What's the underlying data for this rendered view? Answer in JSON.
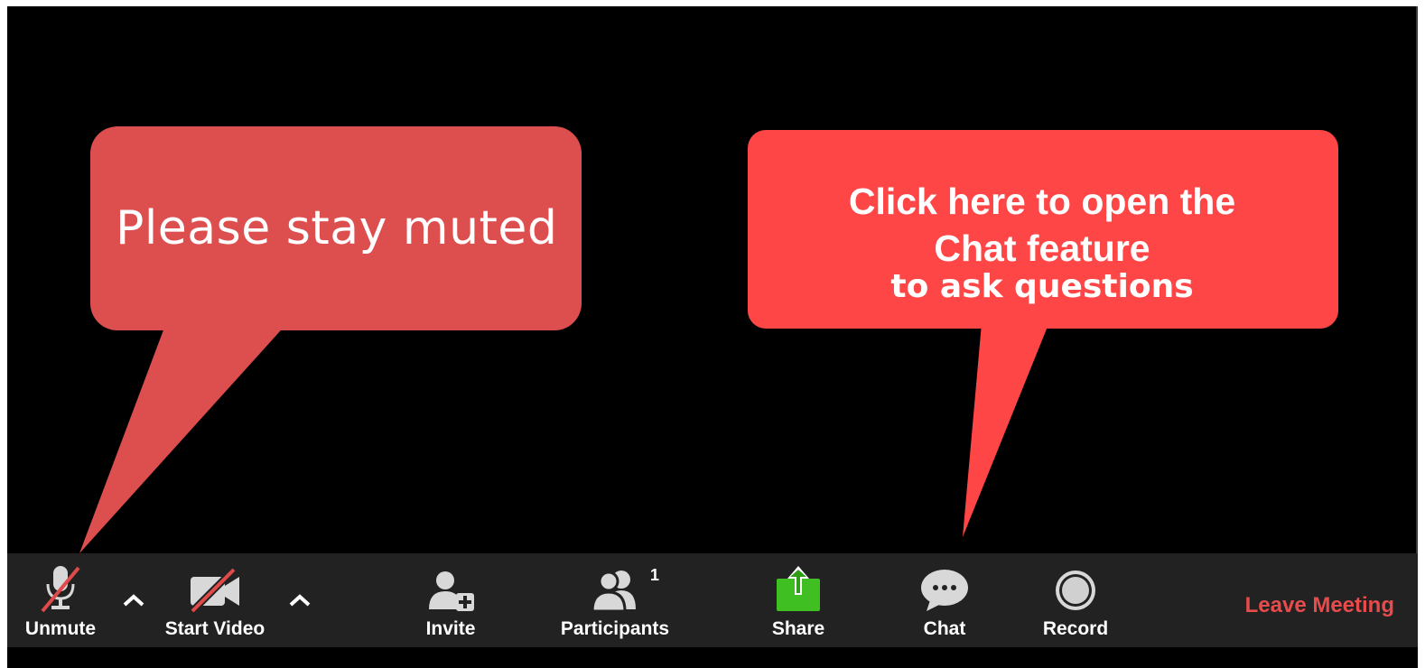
{
  "annotations": {
    "mute_callout": "Please stay muted",
    "chat_callout_line1": "Click here to open the",
    "chat_callout_line2": "Chat feature",
    "chat_callout_line3": "to ask questions"
  },
  "toolbar": {
    "unmute_label": "Unmute",
    "start_video_label": "Start Video",
    "invite_label": "Invite",
    "participants_label": "Participants",
    "participants_count": "1",
    "share_label": "Share",
    "chat_label": "Chat",
    "record_label": "Record",
    "leave_label": "Leave Meeting"
  },
  "icons": {
    "unmute": "microphone-muted-icon",
    "audio_options": "caret-up-icon",
    "start_video": "video-camera-off-icon",
    "video_options": "caret-up-icon",
    "invite": "person-add-icon",
    "participants": "participants-icon",
    "share": "share-screen-icon",
    "chat": "chat-bubble-icon",
    "record": "record-icon"
  },
  "colors": {
    "toolbar_background": "#222222",
    "leave_meeting": "#e84b4b",
    "share_icon": "#3fbf22",
    "mute_callout": "#dd4e4e",
    "chat_callout": "#ff4646",
    "muted_slash": "#e04a4a"
  }
}
